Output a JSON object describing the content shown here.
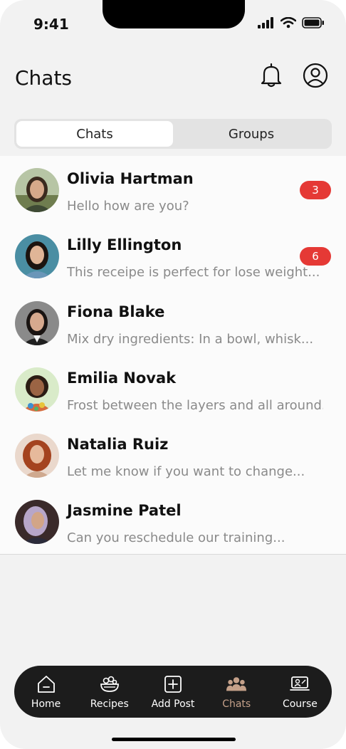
{
  "status": {
    "time": "9:41"
  },
  "header": {
    "title": "Chats",
    "bell_icon": "bell-icon",
    "profile_icon": "user-circle-icon"
  },
  "segments": [
    {
      "label": "Chats",
      "active": true
    },
    {
      "label": "Groups",
      "active": false
    }
  ],
  "chats": [
    {
      "name": "Olivia Hartman",
      "message": "Hello how are you?",
      "badge": "3"
    },
    {
      "name": "Lilly Ellington",
      "message": "This receipe is perfect for lose weight...",
      "badge": "6"
    },
    {
      "name": "Fiona Blake",
      "message": "Mix dry ingredients: In a bowl, whisk...",
      "badge": ""
    },
    {
      "name": "Emilia Novak",
      "message": "Frost between the layers and all around...",
      "badge": ""
    },
    {
      "name": "Natalia Ruiz",
      "message": "Let me know if you want to change...",
      "badge": ""
    },
    {
      "name": "Jasmine Patel",
      "message": "Can you reschedule our training...",
      "badge": ""
    }
  ],
  "tabs": [
    {
      "label": "Home",
      "icon": "home-icon",
      "active": false
    },
    {
      "label": "Recipes",
      "icon": "recipes-icon",
      "active": false
    },
    {
      "label": "Add Post",
      "icon": "add-post-icon",
      "active": false
    },
    {
      "label": "Chats",
      "icon": "chats-icon",
      "active": true
    },
    {
      "label": "Course",
      "icon": "course-icon",
      "active": false
    }
  ],
  "colors": {
    "accent": "#c4a089",
    "badge": "#e53935",
    "tabbar": "#1c1c1c"
  }
}
